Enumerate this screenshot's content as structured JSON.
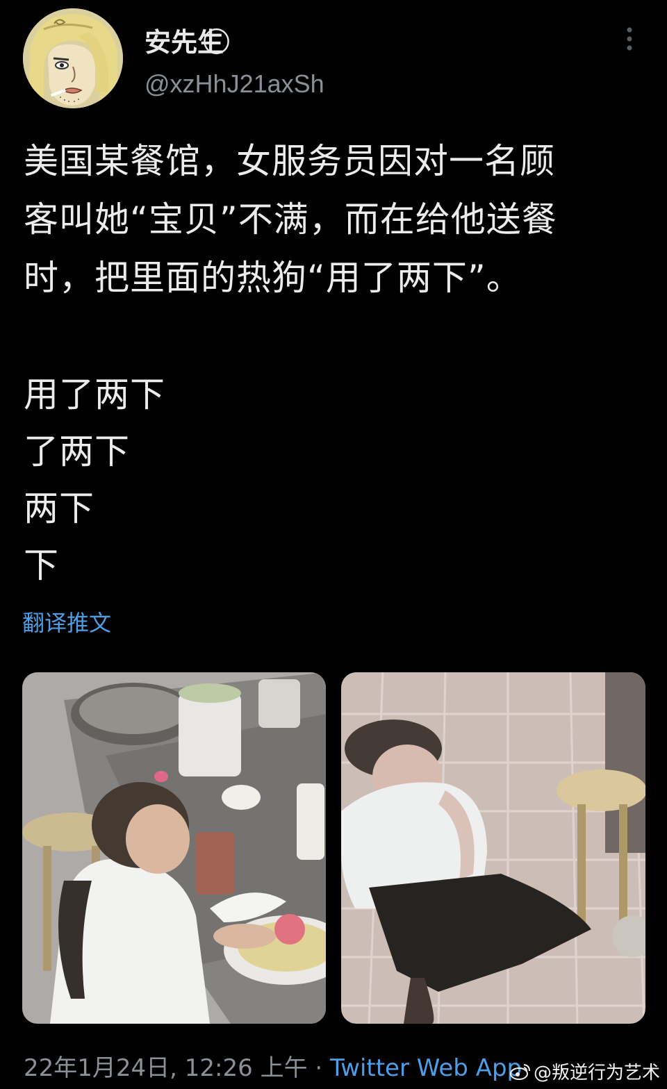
{
  "tweet": {
    "author": {
      "display_name": "安先生 ⃝",
      "handle": "@xzHhJ21axSh"
    },
    "text_main": "美国某餐馆，女服务员因对一名顾\n客叫她“宝贝”不满，而在给他送餐\n时，把里面的热狗“用了两下”。",
    "text_lines": [
      "用了两下",
      "了两下",
      "两下",
      "下"
    ],
    "translate_label": "翻译推文",
    "timestamp": "22年1月24日, 12:26 上午 · ",
    "source_app": "Twitter Web App"
  },
  "watermark": {
    "text": "@叛逆行为艺术"
  },
  "icons": {
    "more": "more-vertical-icon",
    "weibo": "weibo-icon"
  },
  "colors": {
    "background": "#000000",
    "text": "#ececec",
    "secondary": "#8b9096",
    "link": "#4e9ee6"
  }
}
